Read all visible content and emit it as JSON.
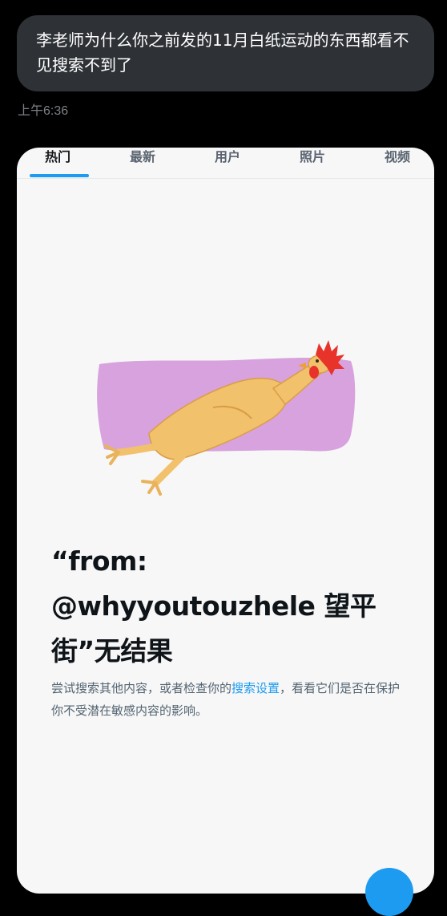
{
  "message": {
    "text": "李老师为什么你之前发的11月白纸运动的东西都看不见搜索不到了",
    "time": "上午6:36"
  },
  "tabs": [
    "热门",
    "最新",
    "用户",
    "照片",
    "视频"
  ],
  "empty_state": {
    "heading": "“from: @whyyoutouzhele 望平街”无结果",
    "desc_before": "尝试搜索其他内容，或者检查你的",
    "desc_link": "搜索设置",
    "desc_after": "，看看它们是否在保护你不受潜在敏感内容的影响。"
  },
  "colors": {
    "accent": "#1d9bf0",
    "bubble": "#2e3236",
    "card": "#f7f7f7",
    "illustration_blob": "#d7a2de"
  },
  "icons": {
    "illustration": "rubber-chicken-icon",
    "fab": "compose-icon"
  }
}
